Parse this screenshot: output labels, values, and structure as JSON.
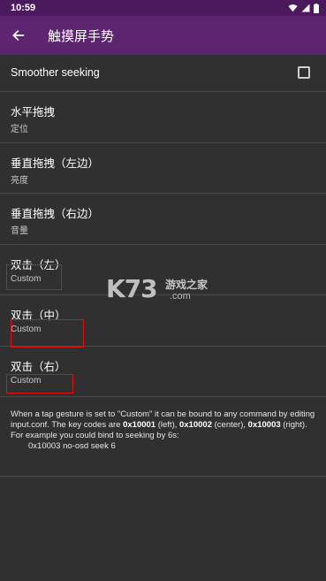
{
  "status_bar": {
    "time": "10:59",
    "icons": [
      "wifi-icon",
      "signal-icon",
      "battery-icon"
    ]
  },
  "app_bar": {
    "title": "触摸屏手势",
    "back_icon": "arrow-back-icon"
  },
  "settings": {
    "smoother_seeking": {
      "label": "Smoother seeking",
      "checked": false
    },
    "horizontal_drag": {
      "title": "水平拖拽",
      "value": "定位"
    },
    "vertical_drag_left": {
      "title": "垂直拖拽（左边）",
      "value": "亮度"
    },
    "vertical_drag_right": {
      "title": "垂直拖拽（右边）",
      "value": "音量"
    },
    "double_tap_left": {
      "title": "双击（左）",
      "value": "Custom"
    },
    "double_tap_center": {
      "title": "双击（中）",
      "value": "Custom"
    },
    "double_tap_right": {
      "title": "双击（右）",
      "value": "Custom"
    }
  },
  "note": {
    "line1_prefix": "When a tap gesture is set to \"Custom\" it can be bound to any command by editing input.conf. The key codes are ",
    "code_left": "0x10001",
    "text_left": " (left), ",
    "code_center": "0x10002",
    "text_center": " (center), ",
    "code_right": "0x10003",
    "text_right": " (right).",
    "line2": "For example you could bind to seeking by 6s:",
    "example": "0x10003 no-osd seek 6"
  },
  "watermark": {
    "logo": "K73",
    "site_name": "游戏之家",
    "domain": ".com"
  },
  "colors": {
    "status_bar": "#4a1a5c",
    "app_bar": "#5d2470",
    "background": "#303030",
    "highlight_box": "#e01010"
  }
}
